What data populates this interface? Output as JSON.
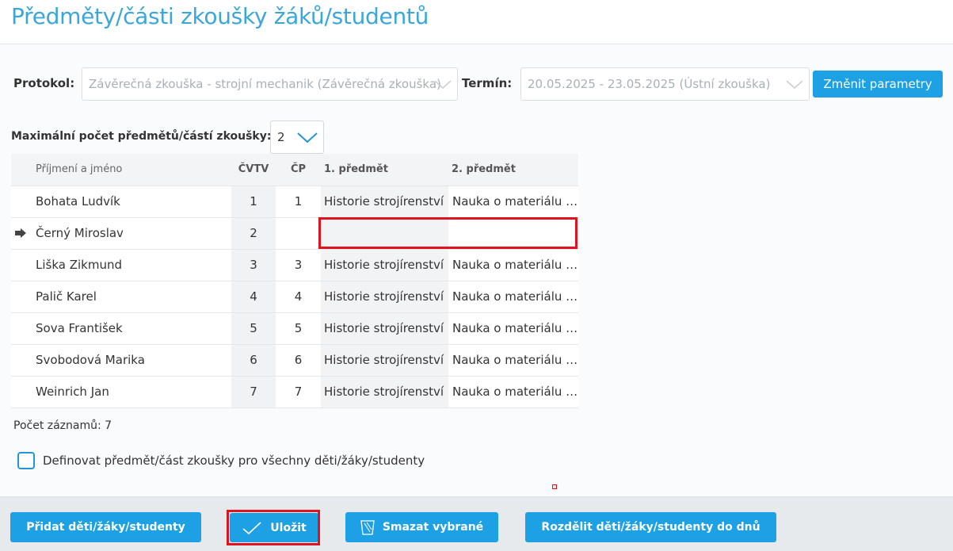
{
  "header": {
    "title": "Předměty/části zkoušky žáků/studentů"
  },
  "filters": {
    "protokol_label": "Protokol:",
    "protokol_value": "Závěrečná zkouška - strojní mechanik (Závěrečná zkouška)",
    "termin_label": "Termín:",
    "termin_value": "20.05.2025 - 23.05.2025 (Ústní zkouška)",
    "change_button": "Změnit parametry"
  },
  "max": {
    "label": "Maximální počet předmětů/částí zkoušky:",
    "value": "2"
  },
  "table": {
    "columns": [
      "Příjmení a jméno",
      "ČVTV",
      "ČP",
      "1. předmět",
      "2. předmět"
    ],
    "rows": [
      {
        "name": "Bohata Ludvík",
        "cvtv": "1",
        "cp": "1",
        "p1": "Historie strojírenství",
        "p2": "Nauka o materiálu a technologii"
      },
      {
        "name": "Černý Miroslav",
        "cvtv": "2",
        "cp": "",
        "p1": "",
        "p2": "",
        "current": true
      },
      {
        "name": "Liška Zikmund",
        "cvtv": "3",
        "cp": "3",
        "p1": "Historie strojírenství",
        "p2": "Nauka o materiálu a technologii"
      },
      {
        "name": "Palič Karel",
        "cvtv": "4",
        "cp": "4",
        "p1": "Historie strojírenství",
        "p2": "Nauka o materiálu a technologii"
      },
      {
        "name": "Sova František",
        "cvtv": "5",
        "cp": "5",
        "p1": "Historie strojírenství",
        "p2": "Nauka o materiálu a technologii"
      },
      {
        "name": "Svobodová Marika",
        "cvtv": "6",
        "cp": "6",
        "p1": "Historie strojírenství",
        "p2": "Nauka o materiálu a technologii"
      },
      {
        "name": "Weinrich Jan",
        "cvtv": "7",
        "cp": "7",
        "p1": "Historie strojírenství",
        "p2": "Nauka o materiálu a technologii"
      }
    ]
  },
  "count_text": "Počet záznamů: 7",
  "define_all": {
    "label": "Definovat předmět/část zkoušky pro všechny děti/žáky/studenty",
    "checked": false
  },
  "footer": {
    "add_button": "Přidat děti/žáky/studenty",
    "save_button": "Uložit",
    "delete_button": "Smazat vybrané",
    "split_button": "Rozdělit děti/žáky/studenty do dnů"
  },
  "colors": {
    "accent": "#1da1e4",
    "title": "#3aa7db",
    "highlight": "#e0141e"
  },
  "icons": {
    "chevron": "chevron-down-icon",
    "row_pointer": "arrow-right-icon",
    "save": "checkmark-icon",
    "delete": "trash-icon"
  }
}
